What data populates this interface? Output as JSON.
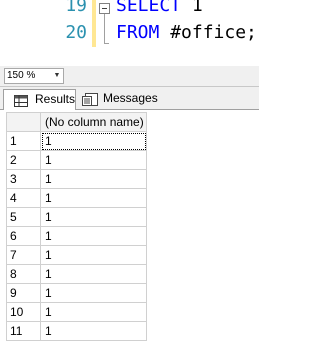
{
  "editor": {
    "lines": [
      {
        "number": "19",
        "keyword": "SELECT",
        "rest": " 1"
      },
      {
        "number": "20",
        "keyword": "FROM",
        "rest": " #office;"
      }
    ]
  },
  "zoom": {
    "value": "150 %"
  },
  "tabs": {
    "results": "Results",
    "messages": "Messages"
  },
  "grid": {
    "column_header": "(No column name)",
    "rows": [
      {
        "num": "1",
        "value": "1"
      },
      {
        "num": "2",
        "value": "1"
      },
      {
        "num": "3",
        "value": "1"
      },
      {
        "num": "4",
        "value": "1"
      },
      {
        "num": "5",
        "value": "1"
      },
      {
        "num": "6",
        "value": "1"
      },
      {
        "num": "7",
        "value": "1"
      },
      {
        "num": "8",
        "value": "1"
      },
      {
        "num": "9",
        "value": "1"
      },
      {
        "num": "10",
        "value": "1"
      },
      {
        "num": "11",
        "value": "1"
      }
    ]
  },
  "colors": {
    "keyword": "#0000ff",
    "line_number": "#2b91af",
    "change_marker": "#ffe793"
  }
}
